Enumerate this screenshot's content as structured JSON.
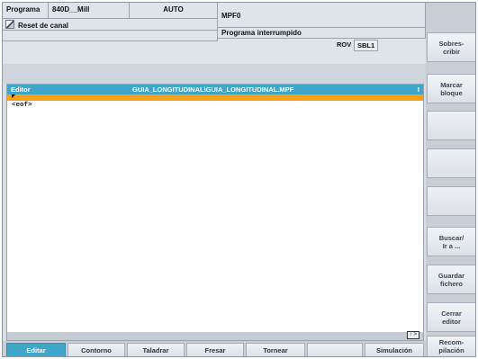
{
  "header": {
    "program_label": "Programa",
    "machine": "840D__Mill",
    "mode": "AUTO",
    "program_file": "MPF0",
    "reset_text": "Reset de canal",
    "status": "Programa interrumpido",
    "rov": "ROV",
    "sbl": "SBL1"
  },
  "editor": {
    "title_label": "Editor",
    "path": "GUIA_LONGITUDINAL\\GUIA_LONGITUDINAL.MPF",
    "title_flag": "I",
    "lines": [
      "<eof>"
    ],
    "page_indicator": "↑ >"
  },
  "right_softkeys": [
    "Sobres-\ncribir",
    "Marcar\nbloque",
    "",
    "",
    "",
    "Buscar/\nIr a ...",
    "Guardar\nfichero",
    "Cerrar\neditor",
    "Recom-\npilación"
  ],
  "bottom_softkeys": [
    "Editar",
    "Contorno",
    "Taladrar",
    "Fresar",
    "Tornear",
    "",
    "Simulación"
  ],
  "colors": {
    "accent": "#3fa5c9",
    "cursor_line": "#f7a11b",
    "background": "#d9dde4"
  }
}
